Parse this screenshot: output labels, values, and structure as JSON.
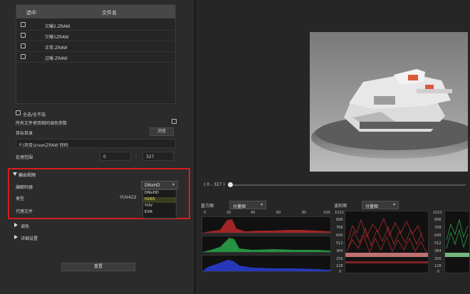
{
  "file_table": {
    "col_select": "选中",
    "col_filename": "文件名",
    "rows": [
      {
        "name": "欠曝2.ZRAW"
      },
      {
        "name": "欠曝1ZRAW"
      },
      {
        "name": "正常.ZRAW"
      },
      {
        "name": "过曝.ZRAW"
      }
    ]
  },
  "options": {
    "select_all_label": "全选/全不选",
    "use_color_params_label": "所有文件使用相同调色参数",
    "target_dir_label": "目标目录",
    "browse_label": "浏览",
    "target_dir_value": "F:\\项目\\zraw\\ZRAW 转码",
    "range_label": "处理范围",
    "range_start": "0",
    "range_sep": "-",
    "range_end": "327"
  },
  "output_settings": {
    "section_title": "输出视频",
    "encoder_label": "编解码器",
    "encoder_value": "DNxHD",
    "type_label": "类型",
    "type_value": "YUV422",
    "proxy_label": "代理文件",
    "encoder_options": [
      "DNxHD",
      "H265",
      "YUV",
      "EXR"
    ],
    "encoder_selected_index": 1
  },
  "sections": {
    "color_label": "调色",
    "advanced_label": "详细设置"
  },
  "reset_label": "重置",
  "timeline": {
    "range_text": "( 0 - 327 )",
    "position": 0
  },
  "scopes": {
    "left_title": "直方图",
    "left_mode": "分量图",
    "right_title": "波形图",
    "right_mode": "分量图",
    "x_ticks": [
      "0",
      "20",
      "40",
      "60",
      "80",
      "100"
    ],
    "y_ticks": [
      "1023",
      "896",
      "768",
      "640",
      "512",
      "384",
      "256",
      "128",
      "0"
    ],
    "colors": {
      "red": "#d83232",
      "green": "#2fb34a",
      "blue": "#2a3fd8"
    }
  }
}
